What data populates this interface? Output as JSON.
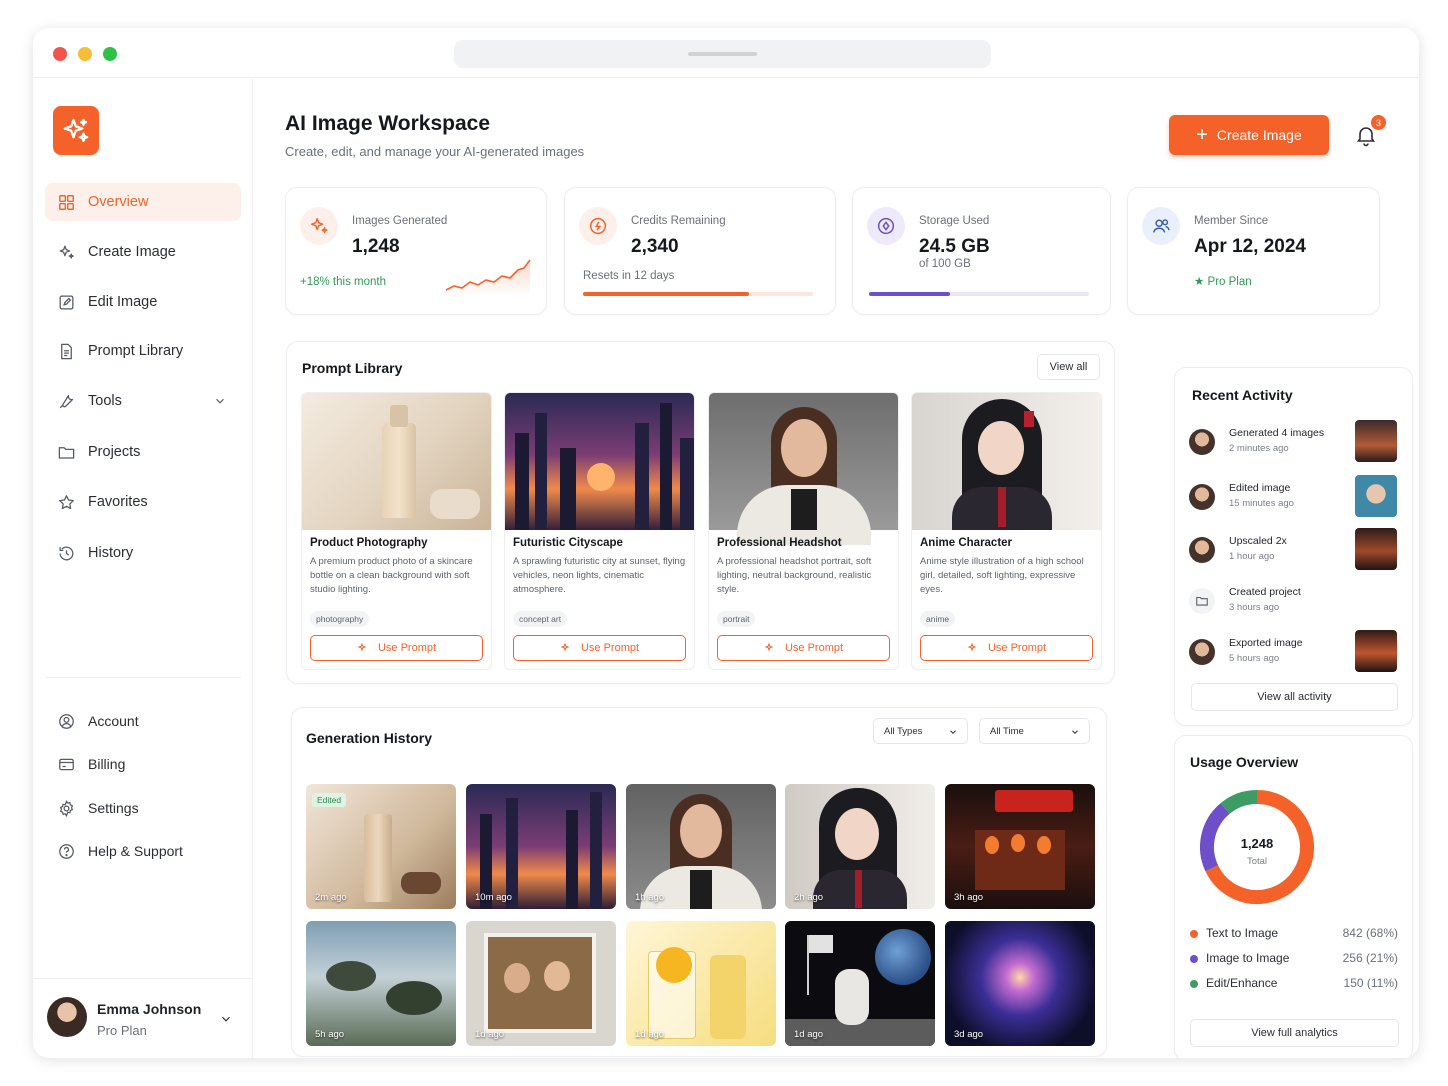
{
  "colors": {
    "accent": "#f4622a",
    "purple": "#6e4fc9",
    "green": "#3e9b63"
  },
  "sidebar": {
    "items": [
      {
        "label": "Overview",
        "icon": "grid-icon"
      },
      {
        "label": "Create Image",
        "icon": "sparkle-icon"
      },
      {
        "label": "Edit Image",
        "icon": "edit-icon"
      },
      {
        "label": "Prompt Library",
        "icon": "document-icon"
      },
      {
        "label": "Tools",
        "icon": "wrench-icon"
      },
      {
        "label": "Projects",
        "icon": "folder-icon"
      },
      {
        "label": "Favorites",
        "icon": "star-icon"
      },
      {
        "label": "History",
        "icon": "history-icon"
      }
    ],
    "secondary": [
      {
        "label": "Account",
        "icon": "user-circle-icon"
      },
      {
        "label": "Billing",
        "icon": "card-icon"
      },
      {
        "label": "Settings",
        "icon": "gear-icon"
      },
      {
        "label": "Help & Support",
        "icon": "help-icon"
      }
    ],
    "user": {
      "name": "Emma Johnson",
      "plan": "Pro Plan"
    }
  },
  "header": {
    "title": "AI Image Workspace",
    "subtitle": "Create, edit, and manage your AI-generated images",
    "create_label": "Create Image",
    "notifications": "3"
  },
  "stats": [
    {
      "label": "Images Generated",
      "value": "1,248",
      "note": "+18% this month"
    },
    {
      "label": "Credits Remaining",
      "value": "2,340",
      "note": "Resets in 12 days",
      "progress": 0.72
    },
    {
      "label": "Storage Used",
      "value": "24.5 GB",
      "note": "of 100 GB",
      "progress": 0.37
    },
    {
      "label": "Member Since",
      "value": "Apr 12, 2024",
      "note": "Pro Plan"
    }
  ],
  "prompt_library": {
    "title": "Prompt Library",
    "view_all": "View all",
    "cards": [
      {
        "title": "Product Photography",
        "desc": "A premium product photo of a skincare bottle on a clean background with soft studio lighting.",
        "tag": "photography",
        "button": "Use Prompt"
      },
      {
        "title": "Futuristic Cityscape",
        "desc": "A sprawling futuristic city at sunset, flying vehicles, neon lights, cinematic atmosphere.",
        "tag": "concept art",
        "button": "Use Prompt"
      },
      {
        "title": "Professional Headshot",
        "desc": "A professional headshot portrait, soft lighting, neutral background, realistic style.",
        "tag": "portrait",
        "button": "Use Prompt"
      },
      {
        "title": "Anime Character",
        "desc": "Anime style illustration of a high school girl, detailed, soft lighting, expressive eyes.",
        "tag": "anime",
        "button": "Use Prompt"
      }
    ]
  },
  "generation_history": {
    "title": "Generation History",
    "filter_type": "All Types",
    "filter_time": "All Time",
    "edited_label": "Edited",
    "items": [
      {
        "time": "2m ago"
      },
      {
        "time": "10m ago"
      },
      {
        "time": "1h ago"
      },
      {
        "time": "2h ago"
      },
      {
        "time": "3h ago"
      },
      {
        "time": "5h ago"
      },
      {
        "time": "1d ago"
      },
      {
        "time": "1d ago"
      },
      {
        "time": "1d ago"
      },
      {
        "time": "3d ago"
      }
    ]
  },
  "recent_activity": {
    "title": "Recent Activity",
    "view_all": "View all activity",
    "items": [
      {
        "text": "Generated 4 images",
        "time": "2 minutes ago"
      },
      {
        "text": "Edited image",
        "time": "15 minutes ago"
      },
      {
        "text": "Upscaled 2x",
        "time": "1 hour ago"
      },
      {
        "text": "Created project",
        "time": "3 hours ago"
      },
      {
        "text": "Exported image",
        "time": "5 hours ago"
      }
    ]
  },
  "usage": {
    "title": "Usage Overview",
    "total": "1,248",
    "total_label": "Total",
    "button": "View full analytics",
    "items": [
      {
        "name": "Text to Image",
        "value": "842 (68%)",
        "pct": 68,
        "color": "#f4622a"
      },
      {
        "name": "Image to Image",
        "value": "256 (21%)",
        "pct": 21,
        "color": "#6e4fc9"
      },
      {
        "name": "Edit/Enhance",
        "value": "150 (11%)",
        "pct": 11,
        "color": "#3e9b63"
      }
    ]
  }
}
